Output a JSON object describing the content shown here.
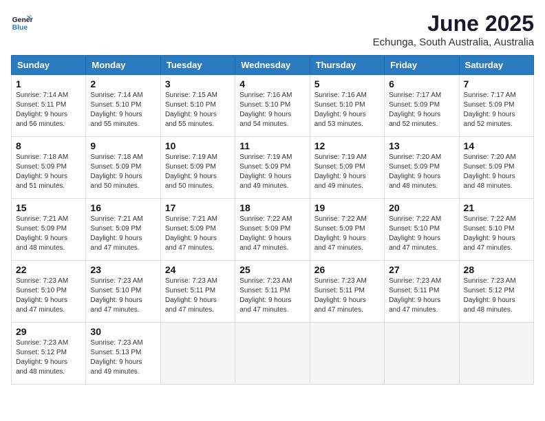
{
  "header": {
    "logo_line1": "General",
    "logo_line2": "Blue",
    "month": "June 2025",
    "location": "Echunga, South Australia, Australia"
  },
  "weekdays": [
    "Sunday",
    "Monday",
    "Tuesday",
    "Wednesday",
    "Thursday",
    "Friday",
    "Saturday"
  ],
  "weeks": [
    [
      {
        "day": "1",
        "info": "Sunrise: 7:14 AM\nSunset: 5:11 PM\nDaylight: 9 hours\nand 56 minutes."
      },
      {
        "day": "2",
        "info": "Sunrise: 7:14 AM\nSunset: 5:10 PM\nDaylight: 9 hours\nand 55 minutes."
      },
      {
        "day": "3",
        "info": "Sunrise: 7:15 AM\nSunset: 5:10 PM\nDaylight: 9 hours\nand 55 minutes."
      },
      {
        "day": "4",
        "info": "Sunrise: 7:16 AM\nSunset: 5:10 PM\nDaylight: 9 hours\nand 54 minutes."
      },
      {
        "day": "5",
        "info": "Sunrise: 7:16 AM\nSunset: 5:10 PM\nDaylight: 9 hours\nand 53 minutes."
      },
      {
        "day": "6",
        "info": "Sunrise: 7:17 AM\nSunset: 5:09 PM\nDaylight: 9 hours\nand 52 minutes."
      },
      {
        "day": "7",
        "info": "Sunrise: 7:17 AM\nSunset: 5:09 PM\nDaylight: 9 hours\nand 52 minutes."
      }
    ],
    [
      {
        "day": "8",
        "info": "Sunrise: 7:18 AM\nSunset: 5:09 PM\nDaylight: 9 hours\nand 51 minutes."
      },
      {
        "day": "9",
        "info": "Sunrise: 7:18 AM\nSunset: 5:09 PM\nDaylight: 9 hours\nand 50 minutes."
      },
      {
        "day": "10",
        "info": "Sunrise: 7:19 AM\nSunset: 5:09 PM\nDaylight: 9 hours\nand 50 minutes."
      },
      {
        "day": "11",
        "info": "Sunrise: 7:19 AM\nSunset: 5:09 PM\nDaylight: 9 hours\nand 49 minutes."
      },
      {
        "day": "12",
        "info": "Sunrise: 7:19 AM\nSunset: 5:09 PM\nDaylight: 9 hours\nand 49 minutes."
      },
      {
        "day": "13",
        "info": "Sunrise: 7:20 AM\nSunset: 5:09 PM\nDaylight: 9 hours\nand 48 minutes."
      },
      {
        "day": "14",
        "info": "Sunrise: 7:20 AM\nSunset: 5:09 PM\nDaylight: 9 hours\nand 48 minutes."
      }
    ],
    [
      {
        "day": "15",
        "info": "Sunrise: 7:21 AM\nSunset: 5:09 PM\nDaylight: 9 hours\nand 48 minutes."
      },
      {
        "day": "16",
        "info": "Sunrise: 7:21 AM\nSunset: 5:09 PM\nDaylight: 9 hours\nand 47 minutes."
      },
      {
        "day": "17",
        "info": "Sunrise: 7:21 AM\nSunset: 5:09 PM\nDaylight: 9 hours\nand 47 minutes."
      },
      {
        "day": "18",
        "info": "Sunrise: 7:22 AM\nSunset: 5:09 PM\nDaylight: 9 hours\nand 47 minutes."
      },
      {
        "day": "19",
        "info": "Sunrise: 7:22 AM\nSunset: 5:09 PM\nDaylight: 9 hours\nand 47 minutes."
      },
      {
        "day": "20",
        "info": "Sunrise: 7:22 AM\nSunset: 5:10 PM\nDaylight: 9 hours\nand 47 minutes."
      },
      {
        "day": "21",
        "info": "Sunrise: 7:22 AM\nSunset: 5:10 PM\nDaylight: 9 hours\nand 47 minutes."
      }
    ],
    [
      {
        "day": "22",
        "info": "Sunrise: 7:23 AM\nSunset: 5:10 PM\nDaylight: 9 hours\nand 47 minutes."
      },
      {
        "day": "23",
        "info": "Sunrise: 7:23 AM\nSunset: 5:10 PM\nDaylight: 9 hours\nand 47 minutes."
      },
      {
        "day": "24",
        "info": "Sunrise: 7:23 AM\nSunset: 5:11 PM\nDaylight: 9 hours\nand 47 minutes."
      },
      {
        "day": "25",
        "info": "Sunrise: 7:23 AM\nSunset: 5:11 PM\nDaylight: 9 hours\nand 47 minutes."
      },
      {
        "day": "26",
        "info": "Sunrise: 7:23 AM\nSunset: 5:11 PM\nDaylight: 9 hours\nand 47 minutes."
      },
      {
        "day": "27",
        "info": "Sunrise: 7:23 AM\nSunset: 5:11 PM\nDaylight: 9 hours\nand 47 minutes."
      },
      {
        "day": "28",
        "info": "Sunrise: 7:23 AM\nSunset: 5:12 PM\nDaylight: 9 hours\nand 48 minutes."
      }
    ],
    [
      {
        "day": "29",
        "info": "Sunrise: 7:23 AM\nSunset: 5:12 PM\nDaylight: 9 hours\nand 48 minutes."
      },
      {
        "day": "30",
        "info": "Sunrise: 7:23 AM\nSunset: 5:13 PM\nDaylight: 9 hours\nand 49 minutes."
      },
      {
        "day": "",
        "info": ""
      },
      {
        "day": "",
        "info": ""
      },
      {
        "day": "",
        "info": ""
      },
      {
        "day": "",
        "info": ""
      },
      {
        "day": "",
        "info": ""
      }
    ]
  ]
}
